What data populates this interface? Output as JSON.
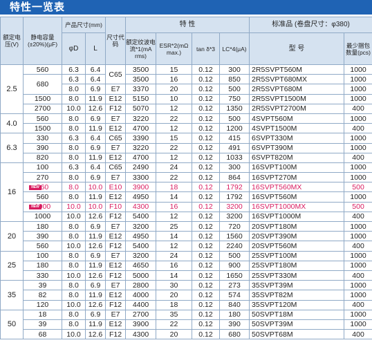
{
  "title": "特性一览表",
  "headers": {
    "rated_voltage": "额定电压(V)",
    "capacitance": "静电容量(±20%)(μF)",
    "size_group": "产品尺寸(mm)",
    "d": "φD",
    "l": "L",
    "size_code": "尺寸代码",
    "characteristics": "特 性",
    "ripple": "额定纹波电流*1(mA rms)",
    "esr": "ESR*2(mΩ max.)",
    "tan": "tan δ*3",
    "lc": "LC*4(μA)",
    "std_group": "标准品 (卷盘尺寸：φ380)",
    "model": "型 号",
    "pcs": "最少捆包数量(pcs)"
  },
  "new_label": "NEW",
  "rows": [
    {
      "v": "2.5",
      "cap": "560",
      "d": "6.3",
      "l": "6.4",
      "code": "C65",
      "rc": "3500",
      "esr": "15",
      "tan": "0.12",
      "lc": "300",
      "model": "2R5SVPT560M",
      "pcs": "1000"
    },
    {
      "v": "",
      "cap": "680",
      "d": "6.3",
      "l": "6.4",
      "code": "",
      "rc": "3500",
      "esr": "16",
      "tan": "0.12",
      "lc": "850",
      "model": "2R5SVPT680MX",
      "pcs": "1000"
    },
    {
      "v": "",
      "cap": "",
      "d": "8.0",
      "l": "6.9",
      "code": "E7",
      "rc": "3370",
      "esr": "20",
      "tan": "0.12",
      "lc": "500",
      "model": "2R5SVPT680M",
      "pcs": "1000"
    },
    {
      "v": "",
      "cap": "1500",
      "d": "8.0",
      "l": "11.9",
      "code": "E12",
      "rc": "5150",
      "esr": "10",
      "tan": "0.12",
      "lc": "750",
      "model": "2R5SVPT1500M",
      "pcs": "1000"
    },
    {
      "v": "",
      "cap": "2700",
      "d": "10.0",
      "l": "12.6",
      "code": "F12",
      "rc": "5070",
      "esr": "12",
      "tan": "0.12",
      "lc": "1350",
      "model": "2R5SVPT2700M",
      "pcs": "400"
    },
    {
      "v": "4.0",
      "cap": "560",
      "d": "8.0",
      "l": "6.9",
      "code": "E7",
      "rc": "3220",
      "esr": "22",
      "tan": "0.12",
      "lc": "500",
      "model": "4SVPT560M",
      "pcs": "1000"
    },
    {
      "v": "",
      "cap": "1500",
      "d": "8.0",
      "l": "11.9",
      "code": "E12",
      "rc": "4700",
      "esr": "12",
      "tan": "0.12",
      "lc": "1200",
      "model": "4SVPT1500M",
      "pcs": "400"
    },
    {
      "v": "6.3",
      "cap": "330",
      "d": "6.3",
      "l": "6.4",
      "code": "C65",
      "rc": "3390",
      "esr": "15",
      "tan": "0.12",
      "lc": "415",
      "model": "6SVPT330M",
      "pcs": "1000"
    },
    {
      "v": "",
      "cap": "390",
      "d": "8.0",
      "l": "6.9",
      "code": "E7",
      "rc": "3220",
      "esr": "22",
      "tan": "0.12",
      "lc": "491",
      "model": "6SVPT390M",
      "pcs": "1000"
    },
    {
      "v": "",
      "cap": "820",
      "d": "8.0",
      "l": "11.9",
      "code": "E12",
      "rc": "4700",
      "esr": "12",
      "tan": "0.12",
      "lc": "1033",
      "model": "6SVPT820M",
      "pcs": "400"
    },
    {
      "v": "16",
      "cap": "100",
      "d": "6.3",
      "l": "6.4",
      "code": "C65",
      "rc": "2490",
      "esr": "24",
      "tan": "0.12",
      "lc": "300",
      "model": "16SVPT100M",
      "pcs": "1000"
    },
    {
      "v": "",
      "cap": "270",
      "d": "8.0",
      "l": "6.9",
      "code": "E7",
      "rc": "3300",
      "esr": "22",
      "tan": "0.12",
      "lc": "864",
      "model": "16SVPT270M",
      "pcs": "1000"
    },
    {
      "v": "",
      "cap": "560",
      "d": "8.0",
      "l": "10.0",
      "code": "E10",
      "rc": "3900",
      "esr": "18",
      "tan": "0.12",
      "lc": "1792",
      "model": "16SVPT560MX",
      "pcs": "500",
      "new": true
    },
    {
      "v": "",
      "cap": "560",
      "d": "8.0",
      "l": "11.9",
      "code": "E12",
      "rc": "4950",
      "esr": "14",
      "tan": "0.12",
      "lc": "1792",
      "model": "16SVPT560M",
      "pcs": "1000"
    },
    {
      "v": "",
      "cap": "1000",
      "d": "10.0",
      "l": "10.0",
      "code": "F10",
      "rc": "4300",
      "esr": "16",
      "tan": "0.12",
      "lc": "3200",
      "model": "16SVPT1000MX",
      "pcs": "500",
      "new": true
    },
    {
      "v": "",
      "cap": "1000",
      "d": "10.0",
      "l": "12.6",
      "code": "F12",
      "rc": "5400",
      "esr": "12",
      "tan": "0.12",
      "lc": "3200",
      "model": "16SVPT1000M",
      "pcs": "400"
    },
    {
      "v": "20",
      "cap": "180",
      "d": "8.0",
      "l": "6.9",
      "code": "E7",
      "rc": "3200",
      "esr": "25",
      "tan": "0.12",
      "lc": "720",
      "model": "20SVPT180M",
      "pcs": "1000"
    },
    {
      "v": "",
      "cap": "390",
      "d": "8.0",
      "l": "11.9",
      "code": "E12",
      "rc": "4950",
      "esr": "14",
      "tan": "0.12",
      "lc": "1560",
      "model": "20SVPT390M",
      "pcs": "1000"
    },
    {
      "v": "",
      "cap": "560",
      "d": "10.0",
      "l": "12.6",
      "code": "F12",
      "rc": "5400",
      "esr": "12",
      "tan": "0.12",
      "lc": "2240",
      "model": "20SVPT560M",
      "pcs": "400"
    },
    {
      "v": "25",
      "cap": "100",
      "d": "8.0",
      "l": "6.9",
      "code": "E7",
      "rc": "3200",
      "esr": "24",
      "tan": "0.12",
      "lc": "500",
      "model": "25SVPT100M",
      "pcs": "1000"
    },
    {
      "v": "",
      "cap": "180",
      "d": "8.0",
      "l": "11.9",
      "code": "E12",
      "rc": "4650",
      "esr": "16",
      "tan": "0.12",
      "lc": "900",
      "model": "25SVPT180M",
      "pcs": "1000"
    },
    {
      "v": "",
      "cap": "330",
      "d": "10.0",
      "l": "12.6",
      "code": "F12",
      "rc": "5000",
      "esr": "14",
      "tan": "0.12",
      "lc": "1650",
      "model": "25SVPT330M",
      "pcs": "400"
    },
    {
      "v": "35",
      "cap": "39",
      "d": "8.0",
      "l": "6.9",
      "code": "E7",
      "rc": "2800",
      "esr": "30",
      "tan": "0.12",
      "lc": "273",
      "model": "35SVPT39M",
      "pcs": "1000"
    },
    {
      "v": "",
      "cap": "82",
      "d": "8.0",
      "l": "11.9",
      "code": "E12",
      "rc": "4000",
      "esr": "20",
      "tan": "0.12",
      "lc": "574",
      "model": "35SVPT82M",
      "pcs": "1000"
    },
    {
      "v": "",
      "cap": "120",
      "d": "10.0",
      "l": "12.6",
      "code": "F12",
      "rc": "4400",
      "esr": "18",
      "tan": "0.12",
      "lc": "840",
      "model": "35SVPT120M",
      "pcs": "400"
    },
    {
      "v": "50",
      "cap": "18",
      "d": "8.0",
      "l": "6.9",
      "code": "E7",
      "rc": "2700",
      "esr": "35",
      "tan": "0.12",
      "lc": "180",
      "model": "50SVPT18M",
      "pcs": "1000"
    },
    {
      "v": "",
      "cap": "39",
      "d": "8.0",
      "l": "11.9",
      "code": "E12",
      "rc": "3900",
      "esr": "22",
      "tan": "0.12",
      "lc": "390",
      "model": "50SVPT39M",
      "pcs": "1000"
    },
    {
      "v": "",
      "cap": "68",
      "d": "10.0",
      "l": "12.6",
      "code": "F12",
      "rc": "4300",
      "esr": "20",
      "tan": "0.12",
      "lc": "680",
      "model": "50SVPT68M",
      "pcs": "400"
    }
  ]
}
